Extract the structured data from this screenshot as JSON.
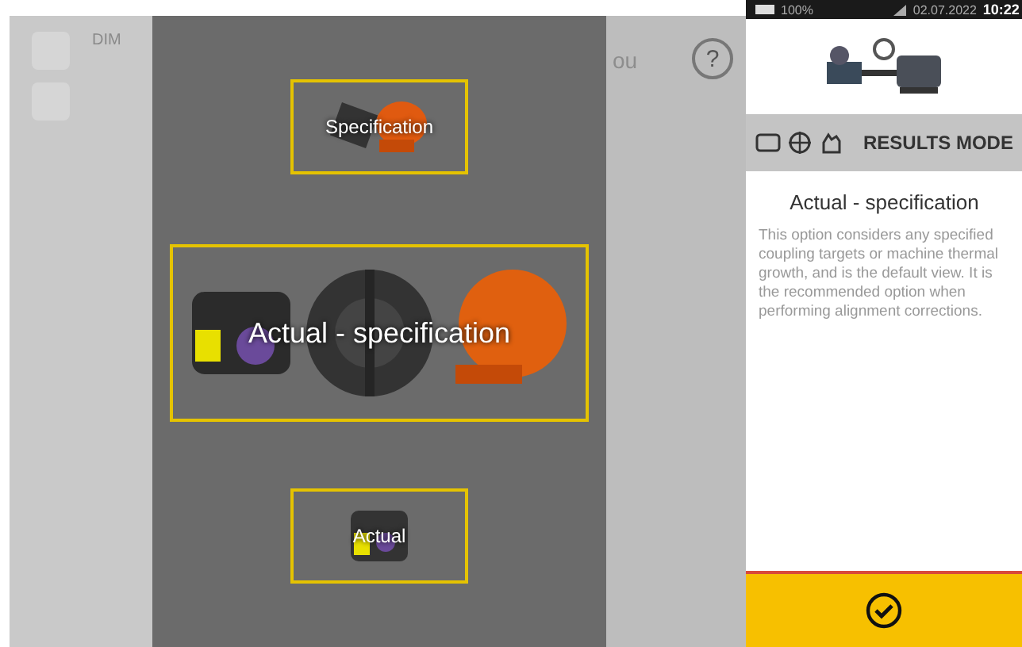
{
  "background": {
    "heading": "DIM",
    "fragment": "ou",
    "help": "?"
  },
  "options": [
    {
      "label": "Specification",
      "selected": false,
      "kind": "specification"
    },
    {
      "label": "Actual - specification",
      "selected": true,
      "kind": "actual-specification"
    },
    {
      "label": "Actual",
      "selected": false,
      "kind": "actual"
    }
  ],
  "status_bar": {
    "battery": "100%",
    "date": "02.07.2022",
    "time": "10:22"
  },
  "panel": {
    "mode": "RESULTS MODE",
    "title": "Actual - specification",
    "description": "This option considers any specified coupling targets or machine thermal growth, and is the default view. It is the recommended option when performing alignment corrections."
  }
}
